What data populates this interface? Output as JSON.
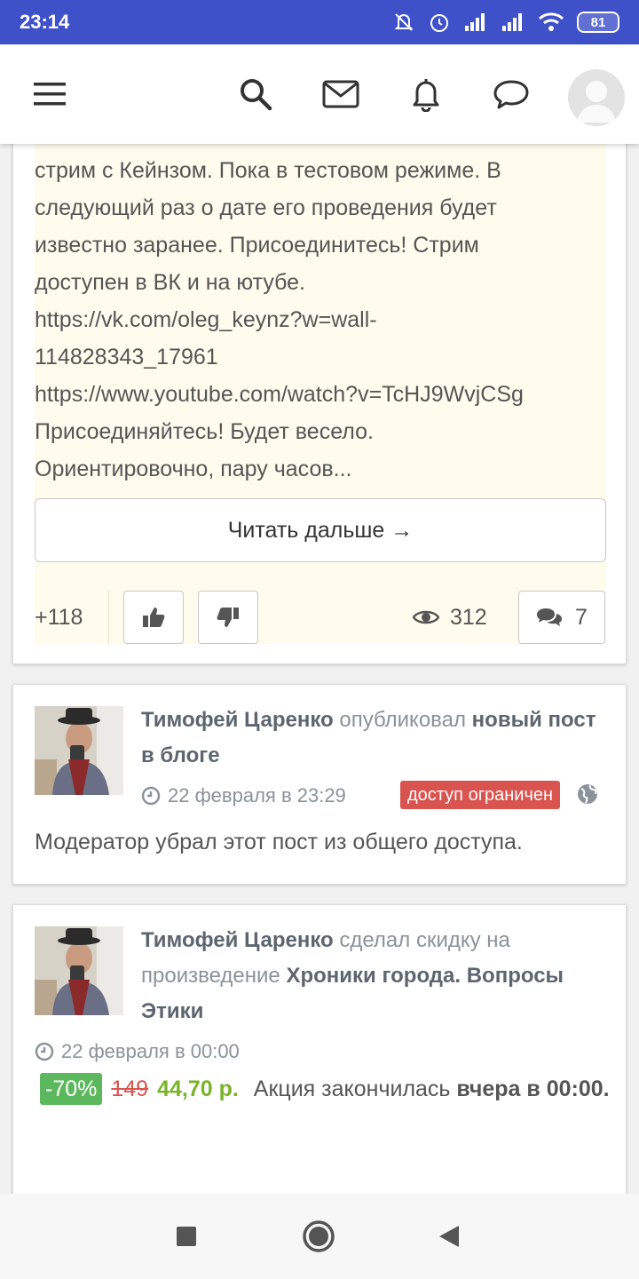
{
  "status_bar": {
    "time": "23:14",
    "battery": "81"
  },
  "top_bar": {
    "icons": [
      "menu-icon",
      "search-icon",
      "mail-icon",
      "bell-icon",
      "chat-icon",
      "avatar"
    ]
  },
  "post1": {
    "text_lines": [
      "стрим с Кейнзом. Пока в тестовом режиме. В",
      "следующий раз о дате его проведения будет",
      "известно заранее. Присоединитесь! Стрим",
      "доступен в ВК и на ютубе.",
      "https://vk.com/oleg_keynz?w=wall-",
      "114828343_17961",
      "https://www.youtube.com/watch?v=TcHJ9WvjCSg",
      "Присоединяйтесь! Будет весело.",
      "Ориентировочно, пару часов..."
    ],
    "read_more": "Читать дальше →",
    "score": "+118",
    "views": "312",
    "comments": "7"
  },
  "post2": {
    "author": "Тимофей Царенко",
    "action": "опубликовал",
    "target": "новый пост в блоге",
    "date": "22 февраля в 23:29",
    "badge": "доступ ограничен",
    "body": "Модератор убрал этот пост из общего доступа."
  },
  "post3": {
    "author": "Тимофей Царенко",
    "action": "сделал скидку на произведение",
    "target": "Хроники города. Вопросы Этики",
    "date": "22 февраля в 00:00",
    "discount": "-70%",
    "old_price": "149",
    "new_price": "44,70 р.",
    "promo_text": "Акция закончилась",
    "promo_end": "вчера в 00:00."
  },
  "colors": {
    "status_bar": "#3f51c9",
    "badge_red": "#d9534f",
    "discount_green": "#5cb85c",
    "price_green": "#7ab32a",
    "post_highlight": "#fffcee"
  }
}
